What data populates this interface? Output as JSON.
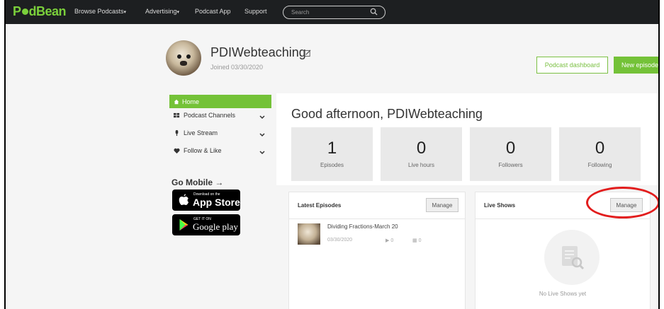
{
  "nav": {
    "logo_a": "P",
    "logo_b": "dBean",
    "items": [
      {
        "label": "Browse Podcasts",
        "caret": "▾"
      },
      {
        "label": "Advertising",
        "caret": "▾"
      },
      {
        "label": "Podcast App",
        "caret": ""
      },
      {
        "label": "Support",
        "caret": ""
      }
    ],
    "search_placeholder": "Search"
  },
  "profile": {
    "username": "PDIWebteaching",
    "joined": "Joined 03/30/2020"
  },
  "actions": {
    "dashboard": "Podcast dashboard",
    "new_episode": "New episode"
  },
  "sidebar": {
    "home": "Home",
    "items": [
      {
        "label": "Podcast Channels"
      },
      {
        "label": "Live Stream"
      },
      {
        "label": "Follow & Like"
      }
    ],
    "go_mobile": "Go Mobile →",
    "app_store_small": "Download on the",
    "app_store_big": "App Store",
    "google_small": "GET IT ON",
    "google_big": "Google play"
  },
  "main": {
    "greeting": "Good afternoon, PDIWebteaching",
    "stats": [
      {
        "value": "1",
        "label": "Episodes"
      },
      {
        "value": "0",
        "label": "Live hours"
      },
      {
        "value": "0",
        "label": "Followers"
      },
      {
        "value": "0",
        "label": "Following"
      }
    ]
  },
  "latest": {
    "title": "Latest Episodes",
    "manage": "Manage",
    "episode": {
      "title": "Dividing Fractions-March 20",
      "date": "03/30/2020",
      "plays": "0",
      "comments": "0"
    }
  },
  "live": {
    "title": "Live Shows",
    "manage": "Manage",
    "empty": "No Live Shows yet"
  },
  "colors": {
    "brand_green": "#74c238",
    "nav_bg": "#1d1f21",
    "annotation_red": "#e21d1d"
  }
}
